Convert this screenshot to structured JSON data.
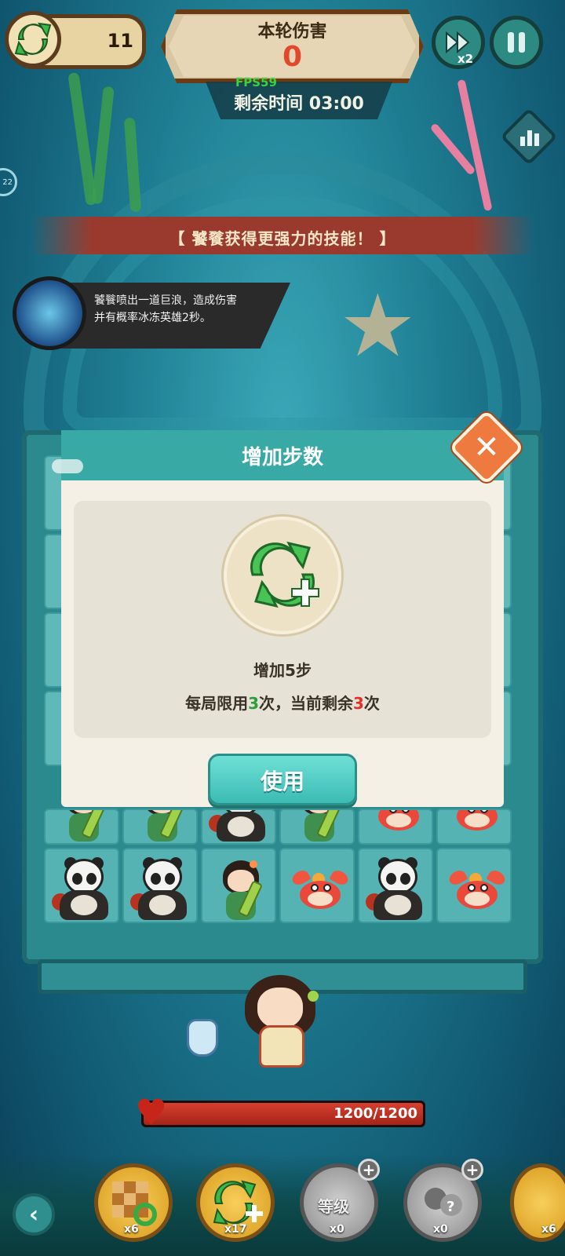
{
  "hud": {
    "moves_left": "11",
    "damage_label": "本轮伤害",
    "damage_value": "0",
    "fps": "FPS59",
    "time_remaining": "剩余时间 03:00",
    "speed_label": "x2",
    "side_badge": "22"
  },
  "banner": {
    "text": "【 饕餮获得更强力的技能！ 】"
  },
  "skill": {
    "description": "饕餮喷出一道巨浪，造成伤害并有概率冰冻英雄2秒。"
  },
  "dialog": {
    "title": "增加步数",
    "effect": "增加5步",
    "limit_prefix": "每局限用",
    "limit_total": "3",
    "limit_middle": "次，当前剩余",
    "limit_remaining": "3",
    "limit_suffix": "次",
    "use_button": "使用"
  },
  "board": {
    "row_top": [
      "girl",
      "girl",
      "panda",
      "girl",
      "fish",
      "fish"
    ],
    "row_bottom": [
      "panda",
      "panda",
      "girl",
      "fish",
      "panda",
      "fish"
    ]
  },
  "hero": {
    "hp_text": "1200/1200",
    "hp_fraction": 1.0
  },
  "items": [
    {
      "name": "shuffle-board",
      "count": "x6"
    },
    {
      "name": "add-moves",
      "count": "x17"
    },
    {
      "name": "level-up",
      "label": "等级",
      "count": "x0"
    },
    {
      "name": "swap-hero",
      "count": "x0"
    },
    {
      "name": "gold-hero",
      "count": "x6"
    }
  ],
  "colors": {
    "accent_teal": "#39a9a5",
    "close_orange": "#ee7a40",
    "damage_red": "#e04a2a",
    "fps_green": "#39d13d"
  }
}
